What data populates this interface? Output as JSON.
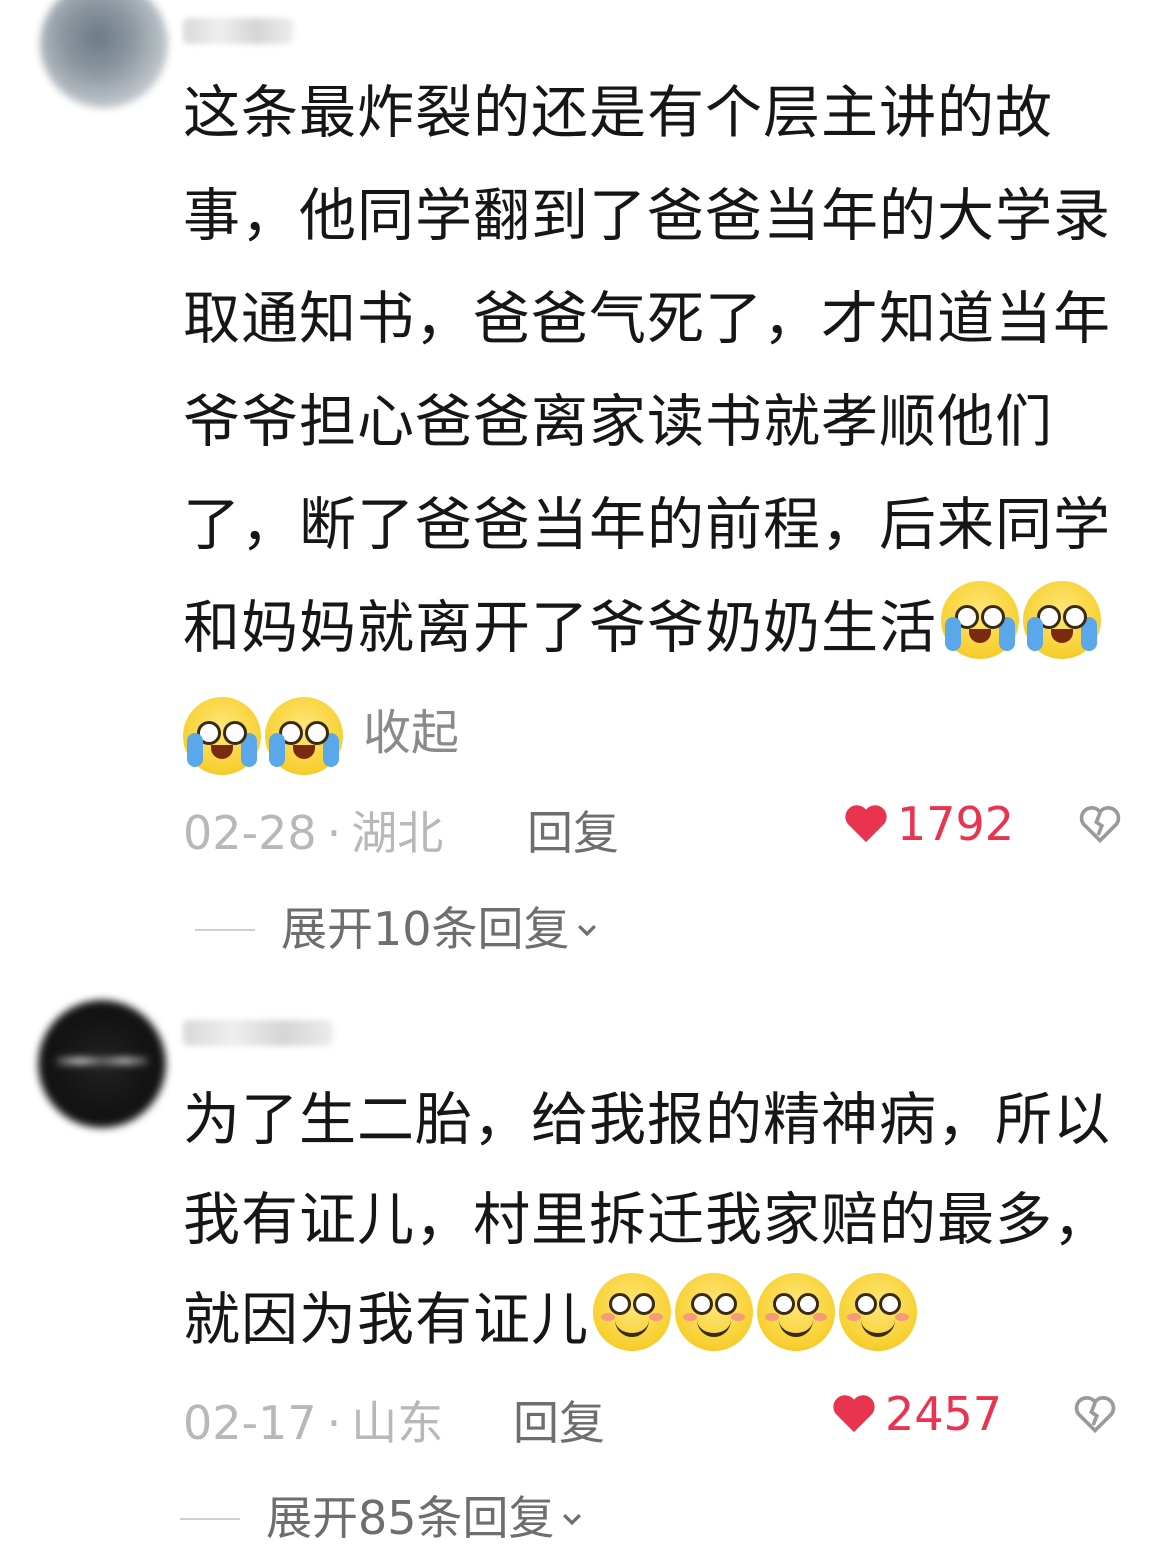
{
  "comments": [
    {
      "username": "",
      "body": "这条最炸裂的还是有个层主讲的故事，他同学翻到了爸爸当年的大学录取通知书，爸爸气死了，才知道当年爷爷担心爸爸离家读书就孝顺他们了，断了爸爸当年的前程，后来同学和妈妈就离开了爷爷奶奶生活",
      "collapse_label": "收起",
      "date": "02-28",
      "separator": "·",
      "region": "湖北",
      "reply_label": "回复",
      "likes": "1792",
      "expand_label": "展开10条回复",
      "emoji": "crying-face"
    },
    {
      "username": "",
      "body": "为了生二胎，给我报的精神病，所以我有证儿，村里拆迁我家赔的最多，就因为我有证儿",
      "date": "02-17",
      "separator": "·",
      "region": "山东",
      "reply_label": "回复",
      "likes": "2457",
      "expand_label": "展开85条回复",
      "emoji": "smiling-face"
    }
  ],
  "colors": {
    "like": "#e8344e",
    "meta": "#b8b8b8",
    "action": "#6e6e6e"
  }
}
